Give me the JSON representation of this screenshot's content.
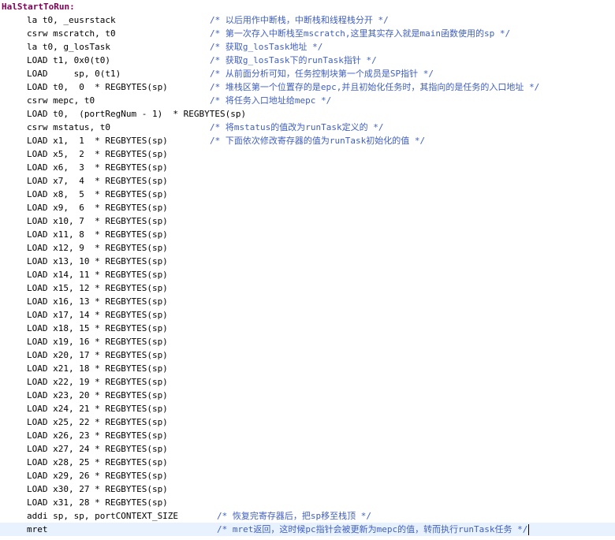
{
  "editor": {
    "colors": {
      "label": "#7f0055",
      "code": "#000000",
      "comment": "#3f5fbf",
      "current_line": "#e8f2fe"
    },
    "lines": [
      {
        "label": "HalStartToRun:",
        "code": "",
        "comment": ""
      },
      {
        "label": "",
        "code": "la t0, _eusrstack",
        "comment": "/* 以后用作中断栈，中断栈和线程栈分开 */"
      },
      {
        "label": "",
        "code": "csrw mscratch, t0",
        "comment": "/* 第一次存入中断栈至mscratch,这里其实存入就是main函数使用的sp */"
      },
      {
        "label": "",
        "code": "la t0, g_losTask",
        "comment": "/* 获取g_losTask地址 */"
      },
      {
        "label": "",
        "code": "LOAD t1, 0x0(t0)",
        "comment": "/* 获取g_losTask下的runTask指针 */"
      },
      {
        "label": "",
        "code": "LOAD     sp, 0(t1)",
        "comment": "/* 从前面分析可知，任务控制块第一个成员是SP指针 */"
      },
      {
        "label": "",
        "code": "LOAD t0,  0  * REGBYTES(sp)",
        "comment": "/* 堆栈区第一个位置存的是epc,并且初始化任务时，其指向的是任务的入口地址 */"
      },
      {
        "label": "",
        "code": "csrw mepc, t0",
        "comment": "/* 将任务入口地址给mepc */"
      },
      {
        "label": "",
        "code": "LOAD t0,  (portRegNum - 1)  * REGBYTES(sp)",
        "comment": ""
      },
      {
        "label": "",
        "code": "csrw mstatus, t0",
        "comment": "/* 将mstatus的值改为runTask定义的 */"
      },
      {
        "label": "",
        "code": "LOAD x1,  1  * REGBYTES(sp)",
        "comment": "/* 下面依次修改寄存器的值为runTask初始化的值 */"
      },
      {
        "label": "",
        "code": "LOAD x5,  2  * REGBYTES(sp)",
        "comment": ""
      },
      {
        "label": "",
        "code": "LOAD x6,  3  * REGBYTES(sp)",
        "comment": ""
      },
      {
        "label": "",
        "code": "LOAD x7,  4  * REGBYTES(sp)",
        "comment": ""
      },
      {
        "label": "",
        "code": "LOAD x8,  5  * REGBYTES(sp)",
        "comment": ""
      },
      {
        "label": "",
        "code": "LOAD x9,  6  * REGBYTES(sp)",
        "comment": ""
      },
      {
        "label": "",
        "code": "LOAD x10, 7  * REGBYTES(sp)",
        "comment": ""
      },
      {
        "label": "",
        "code": "LOAD x11, 8  * REGBYTES(sp)",
        "comment": ""
      },
      {
        "label": "",
        "code": "LOAD x12, 9  * REGBYTES(sp)",
        "comment": ""
      },
      {
        "label": "",
        "code": "LOAD x13, 10 * REGBYTES(sp)",
        "comment": ""
      },
      {
        "label": "",
        "code": "LOAD x14, 11 * REGBYTES(sp)",
        "comment": ""
      },
      {
        "label": "",
        "code": "LOAD x15, 12 * REGBYTES(sp)",
        "comment": ""
      },
      {
        "label": "",
        "code": "LOAD x16, 13 * REGBYTES(sp)",
        "comment": ""
      },
      {
        "label": "",
        "code": "LOAD x17, 14 * REGBYTES(sp)",
        "comment": ""
      },
      {
        "label": "",
        "code": "LOAD x18, 15 * REGBYTES(sp)",
        "comment": ""
      },
      {
        "label": "",
        "code": "LOAD x19, 16 * REGBYTES(sp)",
        "comment": ""
      },
      {
        "label": "",
        "code": "LOAD x20, 17 * REGBYTES(sp)",
        "comment": ""
      },
      {
        "label": "",
        "code": "LOAD x21, 18 * REGBYTES(sp)",
        "comment": ""
      },
      {
        "label": "",
        "code": "LOAD x22, 19 * REGBYTES(sp)",
        "comment": ""
      },
      {
        "label": "",
        "code": "LOAD x23, 20 * REGBYTES(sp)",
        "comment": ""
      },
      {
        "label": "",
        "code": "LOAD x24, 21 * REGBYTES(sp)",
        "comment": ""
      },
      {
        "label": "",
        "code": "LOAD x25, 22 * REGBYTES(sp)",
        "comment": ""
      },
      {
        "label": "",
        "code": "LOAD x26, 23 * REGBYTES(sp)",
        "comment": ""
      },
      {
        "label": "",
        "code": "LOAD x27, 24 * REGBYTES(sp)",
        "comment": ""
      },
      {
        "label": "",
        "code": "LOAD x28, 25 * REGBYTES(sp)",
        "comment": ""
      },
      {
        "label": "",
        "code": "LOAD x29, 26 * REGBYTES(sp)",
        "comment": ""
      },
      {
        "label": "",
        "code": "LOAD x30, 27 * REGBYTES(sp)",
        "comment": ""
      },
      {
        "label": "",
        "code": "LOAD x31, 28 * REGBYTES(sp)",
        "comment": ""
      },
      {
        "label": "",
        "code": "addi sp, sp, portCONTEXT_SIZE",
        "comment": "/* 恢复完寄存器后，把sp移至栈顶 */"
      },
      {
        "label": "",
        "code": "mret",
        "comment": "/* mret返回，这时候pc指针会被更新为mepc的值，转而执行runTask任务 */",
        "current": true
      }
    ]
  }
}
